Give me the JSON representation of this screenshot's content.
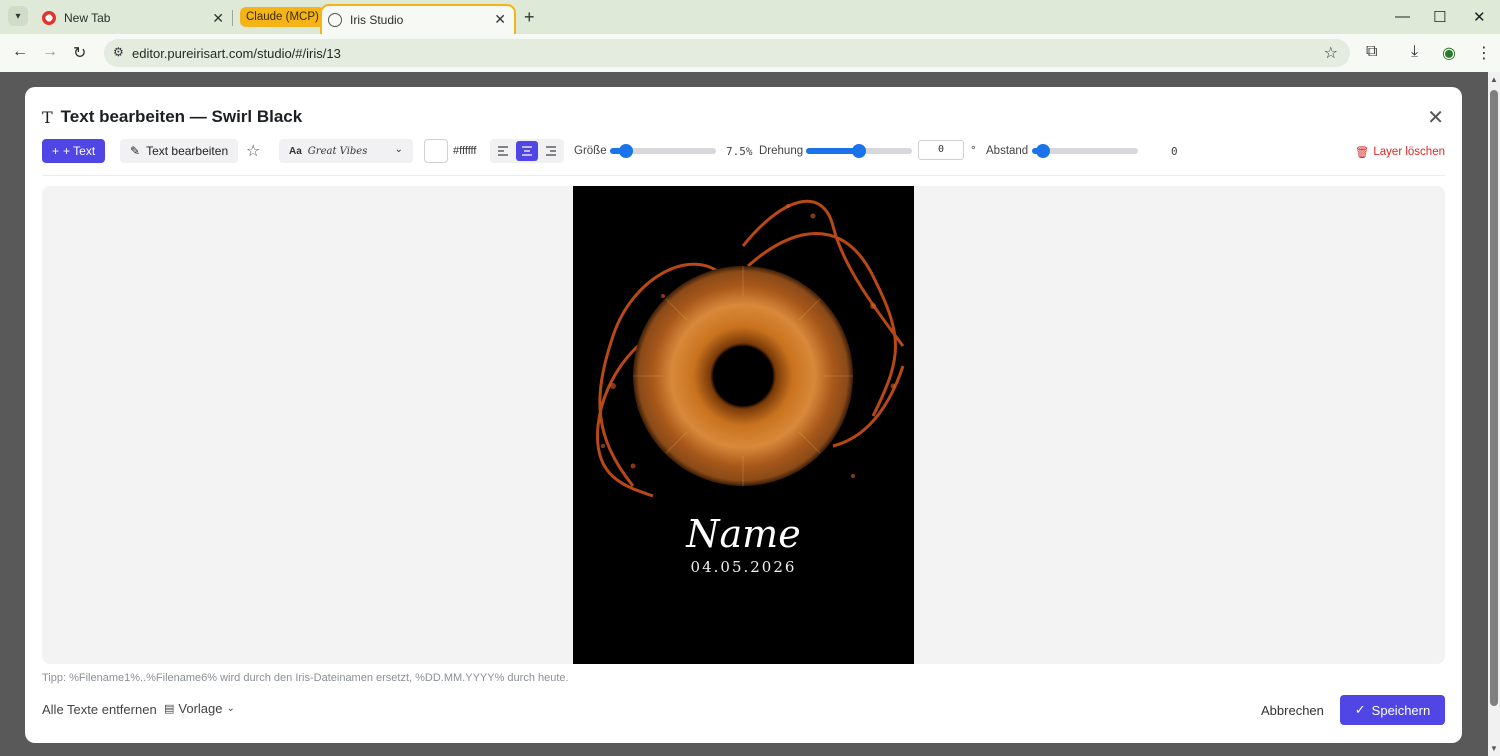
{
  "browser": {
    "tabs": [
      {
        "label": "New Tab",
        "active": false
      },
      {
        "label": "Iris Studio",
        "active": true
      }
    ],
    "tab_group_label": "Claude (MCP)",
    "url": "editor.pureirisart.com/studio/#/iris/13"
  },
  "modal": {
    "title": "Text bearbeiten — Swirl Black",
    "toolbar": {
      "add_text_label": "+ Text",
      "edit_text_label": "Text bearbeiten",
      "font_prefix": "Aa",
      "font_name": "Great Vibes",
      "color_hex": "#ffffff",
      "alignment": "center",
      "size_label": "Größe",
      "size_value": "7.5%",
      "size_fraction": 0.15,
      "rotation_label": "Drehung",
      "rotation_value": "0",
      "rotation_unit": "°",
      "rotation_fraction": 0.5,
      "spacing_label": "Abstand",
      "spacing_value": "0",
      "spacing_fraction": 0.1,
      "delete_layer_label": "Layer löschen"
    },
    "canvas": {
      "name_text": "Name",
      "date_text": "04.05.2026",
      "background": "#000000"
    },
    "tip": "Tipp: %Filename1%..%Filename6% wird durch den Iris-Dateinamen ersetzt, %DD.MM.YYYY% durch heute.",
    "footer": {
      "remove_all_label": "Alle Texte entfernen",
      "template_label": "Vorlage",
      "cancel_label": "Abbrechen",
      "save_label": "Speichern"
    }
  },
  "colors": {
    "accent": "#4f46e5",
    "slider": "#1a73e8",
    "danger": "#dc2626",
    "tab_group": "#f4b418"
  }
}
